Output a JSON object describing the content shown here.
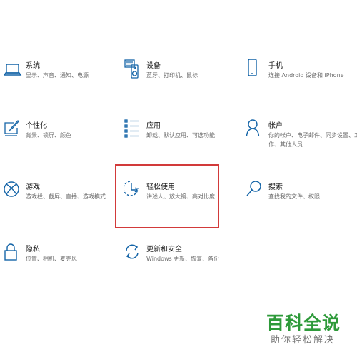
{
  "settings": {
    "tiles": [
      {
        "title": "系统",
        "desc": "显示、声音、通知、电源",
        "icon": "laptop-icon"
      },
      {
        "title": "设备",
        "desc": "蓝牙、打印机、鼠标",
        "icon": "keyboard-speaker-icon"
      },
      {
        "title": "手机",
        "desc": "连接 Android 设备和 iPhone",
        "icon": "phone-icon"
      },
      {
        "title": "个性化",
        "desc": "背景、锁屏、颜色",
        "icon": "paint-brush-icon"
      },
      {
        "title": "应用",
        "desc": "卸载、默认应用、可选功能",
        "icon": "apps-list-icon"
      },
      {
        "title": "帐户",
        "desc": "你的帐户、电子邮件、同步设置、工作、其他人员",
        "icon": "person-icon"
      },
      {
        "title": "游戏",
        "desc": "游戏栏、截屏、直播、游戏模式",
        "icon": "xbox-icon"
      },
      {
        "title": "轻松使用",
        "desc": "讲述人、放大镜、高对比度",
        "icon": "ease-of-access-icon"
      },
      {
        "title": "搜索",
        "desc": "查找我的文件、权限",
        "icon": "search-icon"
      },
      {
        "title": "隐私",
        "desc": "位置、相机、麦克风",
        "icon": "lock-icon"
      },
      {
        "title": "更新和安全",
        "desc": "Windows 更新、恢复、备份",
        "icon": "refresh-icon"
      }
    ]
  },
  "watermark": {
    "main": "百科全说",
    "sub": "助你轻松解决"
  },
  "colors": {
    "icon": "#1565a8",
    "highlight": "#d23a3a",
    "watermark": "#2e9a3a"
  }
}
